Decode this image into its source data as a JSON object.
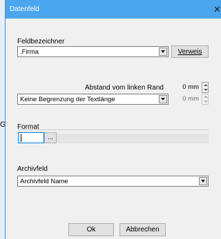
{
  "background": {
    "partial_text": "Ga"
  },
  "dialog": {
    "title": "Datenfeld",
    "close_glyph": "✕"
  },
  "feldbezeichner": {
    "label": "Feldbezeichner",
    "value": ".Firma",
    "button_label": "Verweis"
  },
  "abstand": {
    "label": "Abstand vom linken Rand",
    "value": "0 mm"
  },
  "textlaenge": {
    "value": "Keine Begrenzung der Textlänge",
    "spin_value": "0 mm"
  },
  "format": {
    "label": "Format",
    "ellipsis_label": "..."
  },
  "archivfeld": {
    "label": "Archivfeld",
    "value": "Archivfeld Name"
  },
  "footer": {
    "ok_label": "Ok",
    "cancel_label": "Abbrechen"
  },
  "colors": {
    "titlebar": "#4ba6f0",
    "dialog_bg": "#f0f0f0",
    "focus_border": "#0078d7"
  }
}
